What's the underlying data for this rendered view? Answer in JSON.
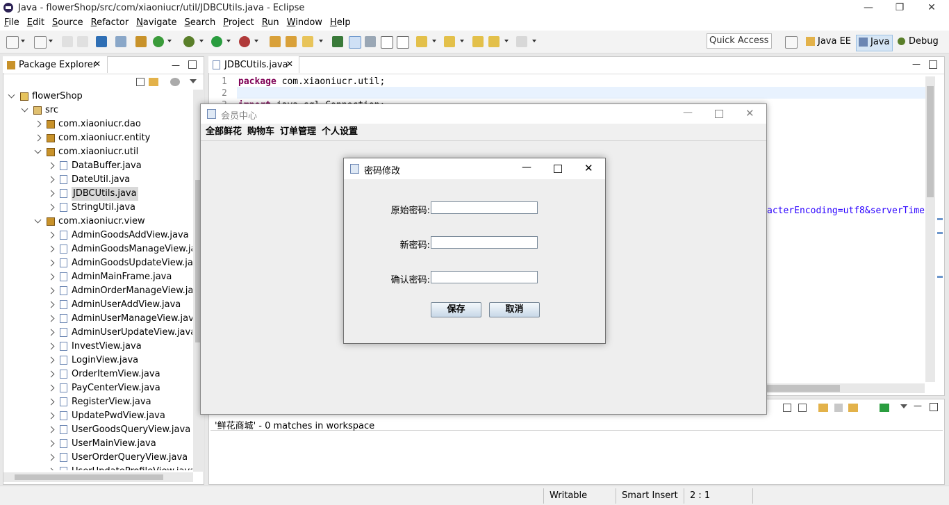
{
  "window": {
    "title": "Java - flowerShop/src/com/xiaoniucr/util/JDBCUtils.java - Eclipse",
    "minimize": "—",
    "maximize": "❐",
    "close": "✕"
  },
  "menu": [
    "File",
    "Edit",
    "Source",
    "Refactor",
    "Navigate",
    "Search",
    "Project",
    "Run",
    "Window",
    "Help"
  ],
  "toolbar": {
    "quick_access": "Quick Access",
    "perspectives": [
      "Java EE",
      "Java",
      "Debug"
    ]
  },
  "package_explorer": {
    "tab_label": "Package Explorer",
    "tree": [
      {
        "label": "flowerShop",
        "level": 0,
        "type": "project",
        "expanded": true
      },
      {
        "label": "src",
        "level": 1,
        "type": "folder",
        "expanded": true
      },
      {
        "label": "com.xiaoniucr.dao",
        "level": 2,
        "type": "package",
        "expanded": false
      },
      {
        "label": "com.xiaoniucr.entity",
        "level": 2,
        "type": "package",
        "expanded": false
      },
      {
        "label": "com.xiaoniucr.util",
        "level": 2,
        "type": "package",
        "expanded": true
      },
      {
        "label": "DataBuffer.java",
        "level": 3,
        "type": "file"
      },
      {
        "label": "DateUtil.java",
        "level": 3,
        "type": "file"
      },
      {
        "label": "JDBCUtils.java",
        "level": 3,
        "type": "file",
        "selected": true
      },
      {
        "label": "StringUtil.java",
        "level": 3,
        "type": "file"
      },
      {
        "label": "com.xiaoniucr.view",
        "level": 2,
        "type": "package",
        "expanded": true
      },
      {
        "label": "AdminGoodsAddView.java",
        "level": 3,
        "type": "file"
      },
      {
        "label": "AdminGoodsManageView.java",
        "level": 3,
        "type": "file"
      },
      {
        "label": "AdminGoodsUpdateView.java",
        "level": 3,
        "type": "file"
      },
      {
        "label": "AdminMainFrame.java",
        "level": 3,
        "type": "file"
      },
      {
        "label": "AdminOrderManageView.java",
        "level": 3,
        "type": "file"
      },
      {
        "label": "AdminUserAddView.java",
        "level": 3,
        "type": "file"
      },
      {
        "label": "AdminUserManageView.java",
        "level": 3,
        "type": "file"
      },
      {
        "label": "AdminUserUpdateView.java",
        "level": 3,
        "type": "file"
      },
      {
        "label": "InvestView.java",
        "level": 3,
        "type": "file"
      },
      {
        "label": "LoginView.java",
        "level": 3,
        "type": "file"
      },
      {
        "label": "OrderItemView.java",
        "level": 3,
        "type": "file"
      },
      {
        "label": "PayCenterView.java",
        "level": 3,
        "type": "file"
      },
      {
        "label": "RegisterView.java",
        "level": 3,
        "type": "file"
      },
      {
        "label": "UpdatePwdView.java",
        "level": 3,
        "type": "file"
      },
      {
        "label": "UserGoodsQueryView.java",
        "level": 3,
        "type": "file"
      },
      {
        "label": "UserMainView.java",
        "level": 3,
        "type": "file"
      },
      {
        "label": "UserOrderQueryView.java",
        "level": 3,
        "type": "file"
      },
      {
        "label": "UserUpdateProfileView.java",
        "level": 3,
        "type": "file"
      }
    ]
  },
  "editor": {
    "tab_label": "JDBCUtils.java",
    "line_numbers": [
      "1",
      "2",
      "3"
    ],
    "line1_keyword": "package",
    "line1_rest": " com.xiaoniucr.util;",
    "line3_keyword": "import",
    "line3_rest": " java.sql.Connection;",
    "visible_fragment": "acterEncoding=utf8&serverTime"
  },
  "search_view": {
    "result": "'鲜花商城' - 0 matches in workspace"
  },
  "statusbar": {
    "writable": "Writable",
    "insert_mode": "Smart Insert",
    "position": "2 : 1"
  },
  "member_window": {
    "title": "会员中心",
    "menu": [
      "全部鲜花",
      "购物车",
      "订单管理",
      "个人设置"
    ]
  },
  "pwd_dialog": {
    "title": "密码修改",
    "labels": {
      "old": "原始密码:",
      "new": "新密码:",
      "confirm": "确认密码:"
    },
    "buttons": {
      "save": "保存",
      "cancel": "取消"
    }
  }
}
